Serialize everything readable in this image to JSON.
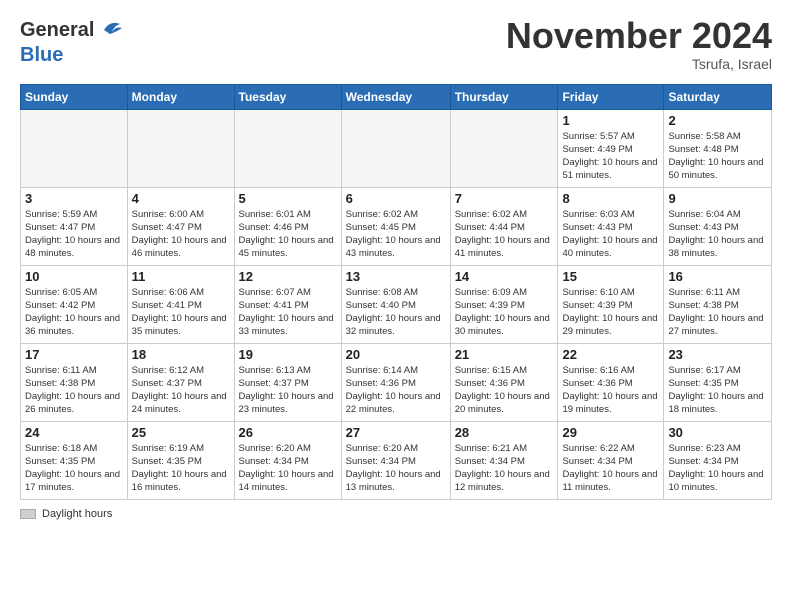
{
  "header": {
    "logo_line1": "General",
    "logo_line2": "Blue",
    "month": "November 2024",
    "location": "Tsrufa, Israel"
  },
  "legend": {
    "label": "Daylight hours"
  },
  "days_of_week": [
    "Sunday",
    "Monday",
    "Tuesday",
    "Wednesday",
    "Thursday",
    "Friday",
    "Saturday"
  ],
  "weeks": [
    [
      {
        "day": "",
        "info": ""
      },
      {
        "day": "",
        "info": ""
      },
      {
        "day": "",
        "info": ""
      },
      {
        "day": "",
        "info": ""
      },
      {
        "day": "",
        "info": ""
      },
      {
        "day": "1",
        "info": "Sunrise: 5:57 AM\nSunset: 4:49 PM\nDaylight: 10 hours and 51 minutes."
      },
      {
        "day": "2",
        "info": "Sunrise: 5:58 AM\nSunset: 4:48 PM\nDaylight: 10 hours and 50 minutes."
      }
    ],
    [
      {
        "day": "3",
        "info": "Sunrise: 5:59 AM\nSunset: 4:47 PM\nDaylight: 10 hours and 48 minutes."
      },
      {
        "day": "4",
        "info": "Sunrise: 6:00 AM\nSunset: 4:47 PM\nDaylight: 10 hours and 46 minutes."
      },
      {
        "day": "5",
        "info": "Sunrise: 6:01 AM\nSunset: 4:46 PM\nDaylight: 10 hours and 45 minutes."
      },
      {
        "day": "6",
        "info": "Sunrise: 6:02 AM\nSunset: 4:45 PM\nDaylight: 10 hours and 43 minutes."
      },
      {
        "day": "7",
        "info": "Sunrise: 6:02 AM\nSunset: 4:44 PM\nDaylight: 10 hours and 41 minutes."
      },
      {
        "day": "8",
        "info": "Sunrise: 6:03 AM\nSunset: 4:43 PM\nDaylight: 10 hours and 40 minutes."
      },
      {
        "day": "9",
        "info": "Sunrise: 6:04 AM\nSunset: 4:43 PM\nDaylight: 10 hours and 38 minutes."
      }
    ],
    [
      {
        "day": "10",
        "info": "Sunrise: 6:05 AM\nSunset: 4:42 PM\nDaylight: 10 hours and 36 minutes."
      },
      {
        "day": "11",
        "info": "Sunrise: 6:06 AM\nSunset: 4:41 PM\nDaylight: 10 hours and 35 minutes."
      },
      {
        "day": "12",
        "info": "Sunrise: 6:07 AM\nSunset: 4:41 PM\nDaylight: 10 hours and 33 minutes."
      },
      {
        "day": "13",
        "info": "Sunrise: 6:08 AM\nSunset: 4:40 PM\nDaylight: 10 hours and 32 minutes."
      },
      {
        "day": "14",
        "info": "Sunrise: 6:09 AM\nSunset: 4:39 PM\nDaylight: 10 hours and 30 minutes."
      },
      {
        "day": "15",
        "info": "Sunrise: 6:10 AM\nSunset: 4:39 PM\nDaylight: 10 hours and 29 minutes."
      },
      {
        "day": "16",
        "info": "Sunrise: 6:11 AM\nSunset: 4:38 PM\nDaylight: 10 hours and 27 minutes."
      }
    ],
    [
      {
        "day": "17",
        "info": "Sunrise: 6:11 AM\nSunset: 4:38 PM\nDaylight: 10 hours and 26 minutes."
      },
      {
        "day": "18",
        "info": "Sunrise: 6:12 AM\nSunset: 4:37 PM\nDaylight: 10 hours and 24 minutes."
      },
      {
        "day": "19",
        "info": "Sunrise: 6:13 AM\nSunset: 4:37 PM\nDaylight: 10 hours and 23 minutes."
      },
      {
        "day": "20",
        "info": "Sunrise: 6:14 AM\nSunset: 4:36 PM\nDaylight: 10 hours and 22 minutes."
      },
      {
        "day": "21",
        "info": "Sunrise: 6:15 AM\nSunset: 4:36 PM\nDaylight: 10 hours and 20 minutes."
      },
      {
        "day": "22",
        "info": "Sunrise: 6:16 AM\nSunset: 4:36 PM\nDaylight: 10 hours and 19 minutes."
      },
      {
        "day": "23",
        "info": "Sunrise: 6:17 AM\nSunset: 4:35 PM\nDaylight: 10 hours and 18 minutes."
      }
    ],
    [
      {
        "day": "24",
        "info": "Sunrise: 6:18 AM\nSunset: 4:35 PM\nDaylight: 10 hours and 17 minutes."
      },
      {
        "day": "25",
        "info": "Sunrise: 6:19 AM\nSunset: 4:35 PM\nDaylight: 10 hours and 16 minutes."
      },
      {
        "day": "26",
        "info": "Sunrise: 6:20 AM\nSunset: 4:34 PM\nDaylight: 10 hours and 14 minutes."
      },
      {
        "day": "27",
        "info": "Sunrise: 6:20 AM\nSunset: 4:34 PM\nDaylight: 10 hours and 13 minutes."
      },
      {
        "day": "28",
        "info": "Sunrise: 6:21 AM\nSunset: 4:34 PM\nDaylight: 10 hours and 12 minutes."
      },
      {
        "day": "29",
        "info": "Sunrise: 6:22 AM\nSunset: 4:34 PM\nDaylight: 10 hours and 11 minutes."
      },
      {
        "day": "30",
        "info": "Sunrise: 6:23 AM\nSunset: 4:34 PM\nDaylight: 10 hours and 10 minutes."
      }
    ]
  ]
}
